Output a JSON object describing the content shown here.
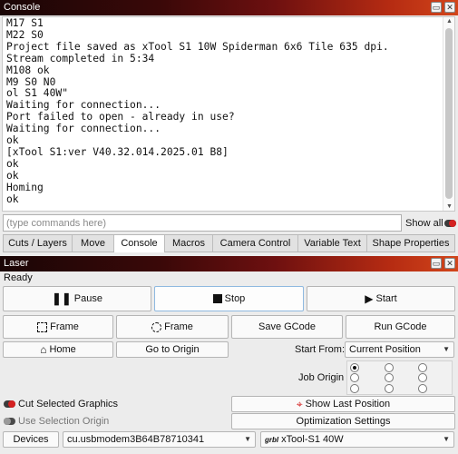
{
  "console": {
    "title": "Console",
    "lines": [
      "M17 S1",
      "M22 S0",
      "Project file saved as xTool S1 10W Spiderman 6x6 Tile 635 dpi.",
      "Stream completed in 5:34",
      "M108 ok",
      "M9 S0 N0",
      "ol S1 40W\"",
      "Waiting for connection...",
      "Port failed to open - already in use?",
      "Waiting for connection...",
      "ok",
      "[xTool S1:ver V40.32.014.2025.01 B8]",
      "ok",
      "ok",
      "Homing",
      "ok"
    ],
    "input_placeholder": "(type commands here)",
    "show_all_label": "Show all"
  },
  "tabs": [
    "Cuts / Layers",
    "Move",
    "Console",
    "Macros",
    "Camera Control",
    "Variable Text",
    "Shape Properties"
  ],
  "active_tab": "Console",
  "laser": {
    "title": "Laser",
    "status": "Ready",
    "pause_label": "Pause",
    "stop_label": "Stop",
    "start_label": "Start",
    "frame_rect_label": "Frame",
    "frame_circle_label": "Frame",
    "save_gcode_label": "Save GCode",
    "run_gcode_label": "Run GCode",
    "home_label": "Home",
    "go_to_origin_label": "Go to Origin",
    "start_from_label": "Start From:",
    "start_from_value": "Current Position",
    "job_origin_label": "Job Origin",
    "job_origin_selected": "top-left",
    "cut_selected_label": "Cut Selected Graphics",
    "cut_selected_on": true,
    "use_selection_origin_label": "Use Selection Origin",
    "use_selection_origin_on": false,
    "show_last_position_label": "Show Last Position",
    "optimization_settings_label": "Optimization Settings",
    "devices_label": "Devices",
    "port_value": "cu.usbmodem3B64B78710341",
    "device_prefix": "grbl",
    "device_value": "xTool-S1 40W"
  },
  "colors": {
    "accent_red": "#d42020",
    "title_dark": "#1a0606",
    "title_orange": "#d2451a",
    "selected_border": "#8fb9e0"
  }
}
